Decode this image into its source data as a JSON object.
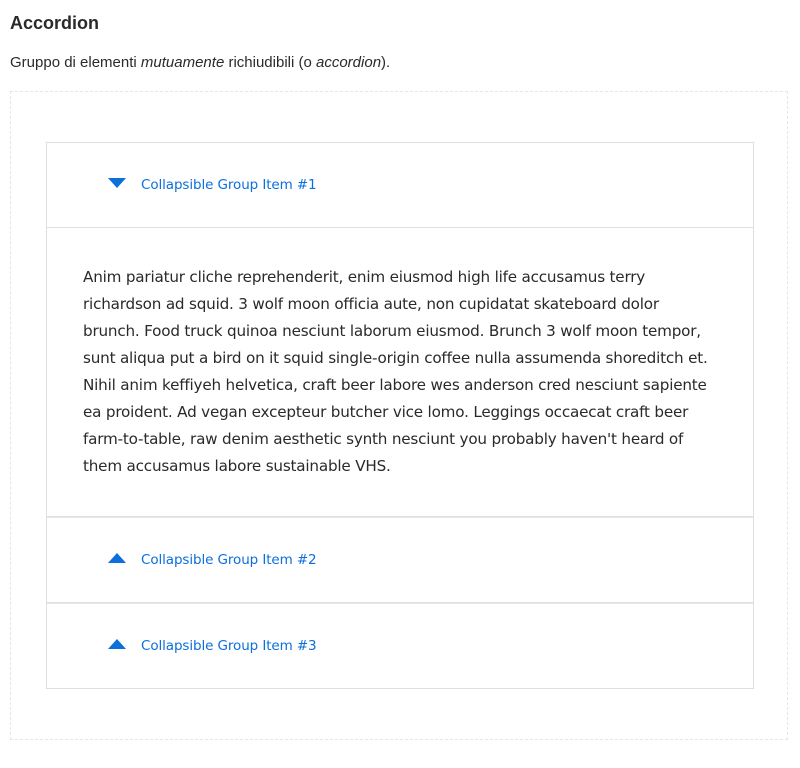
{
  "page": {
    "title": "Accordion",
    "description_parts": {
      "p1": "Gruppo di elementi ",
      "p2": "mutuamente",
      "p3": " richiudibili (o ",
      "p4": "accordion",
      "p5": ")."
    }
  },
  "accordion": {
    "accent_color": "#0b6fdc",
    "items": [
      {
        "label": "Collapsible Group Item #1",
        "expanded": true,
        "icon": "caret-down-icon",
        "body": "Anim pariatur cliche reprehenderit, enim eiusmod high life accusamus terry richardson ad squid. 3 wolf moon officia aute, non cupidatat skateboard dolor brunch. Food truck quinoa nesciunt laborum eiusmod. Brunch 3 wolf moon tempor, sunt aliqua put a bird on it squid single-origin coffee nulla assumenda shoreditch et. Nihil anim keffiyeh helvetica, craft beer labore wes anderson cred nesciunt sapiente ea proident. Ad vegan excepteur butcher vice lomo. Leggings occaecat craft beer farm-to-table, raw denim aesthetic synth nesciunt you probably haven't heard of them accusamus labore sustainable VHS."
      },
      {
        "label": "Collapsible Group Item #2",
        "expanded": false,
        "icon": "caret-up-icon"
      },
      {
        "label": "Collapsible Group Item #3",
        "expanded": false,
        "icon": "caret-up-icon"
      }
    ]
  }
}
